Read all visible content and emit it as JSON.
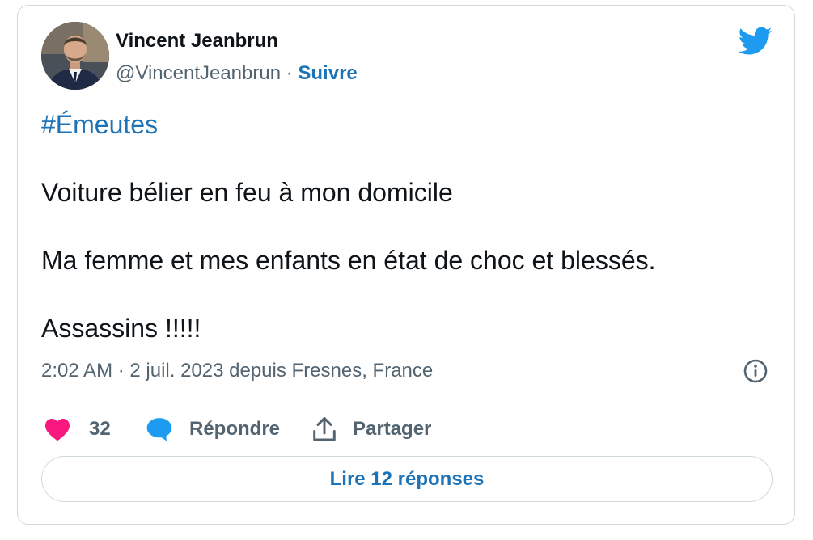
{
  "author": {
    "display_name": "Vincent Jeanbrun",
    "handle": "@VincentJeanbrun",
    "separator": " · ",
    "follow_label": "Suivre"
  },
  "tweet": {
    "hashtag": "#Émeutes",
    "lines": [
      "Voiture bélier en feu à mon domicile",
      "Ma femme et mes enfants en état de choc et blessés.",
      "Assassins !!!!!"
    ],
    "meta": "2:02 AM · 2 juil. 2023 depuis Fresnes, France"
  },
  "actions": {
    "like_count": "32",
    "reply_label": "Répondre",
    "share_label": "Partager"
  },
  "read_replies_label": "Lire 12 réponses",
  "icons": {
    "brand": "twitter-bird-icon",
    "info": "info-icon",
    "like": "heart-icon",
    "reply": "speech-bubble-icon",
    "share": "share-upload-icon"
  },
  "colors": {
    "link_blue": "#1d73b5",
    "twitter_blue": "#1d9bf0",
    "heart_pink": "#f91880",
    "secondary_text": "#536471",
    "primary_text": "#0f1419",
    "border": "#cfd9de"
  }
}
